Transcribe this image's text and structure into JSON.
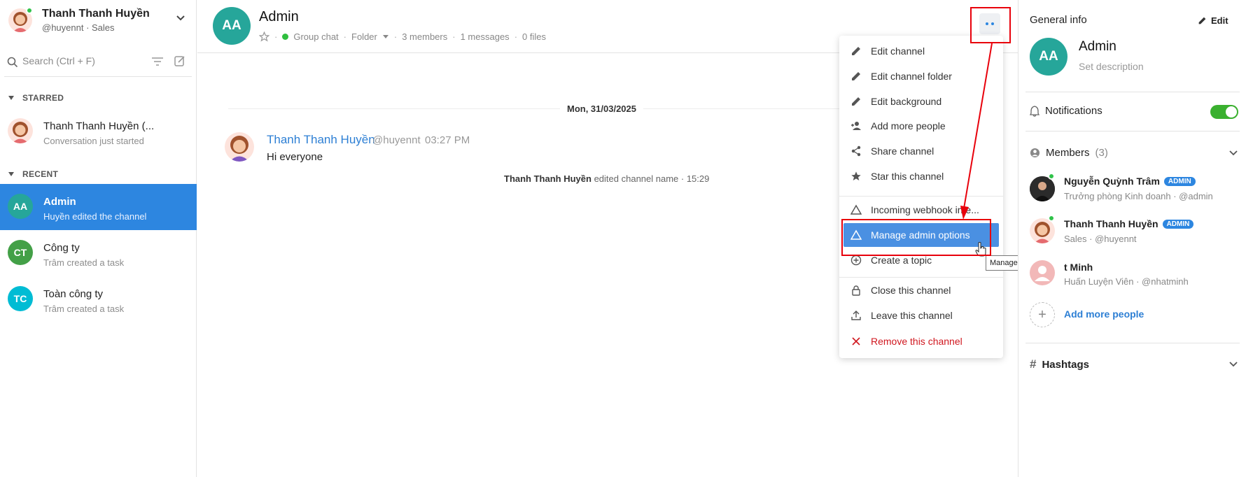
{
  "colors": {
    "accent": "#2d86e0",
    "online": "#30c24a",
    "danger": "#d0171f",
    "annotation": "#e8000b",
    "highlight": "#4a90e2"
  },
  "sidebar": {
    "user": {
      "name": "Thanh Thanh Huyền",
      "subtitle": "@huyennt · Sales"
    },
    "search": {
      "placeholder": "Search (Ctrl + F)"
    },
    "starred_label": "STARRED",
    "recent_label": "RECENT",
    "starred": [
      {
        "title": "Thanh Thanh Huyền (...",
        "subtitle": "Conversation just started"
      }
    ],
    "recent": [
      {
        "initials": "AA",
        "title": "Admin",
        "subtitle": "Huyền edited the channel",
        "color": "#26a69a"
      },
      {
        "initials": "CT",
        "title": "Công ty",
        "subtitle": "Trâm created a task",
        "color": "#43a047"
      },
      {
        "initials": "TC",
        "title": "Toàn công ty",
        "subtitle": "Trâm created a task",
        "color": "#00bcd4"
      }
    ]
  },
  "channel": {
    "initials": "AA",
    "title": "Admin",
    "type": "Group chat",
    "folder": "Folder",
    "members": "3 members",
    "messages": "1 messages",
    "files": "0 files"
  },
  "chat": {
    "date": "Mon, 31/03/2025",
    "message": {
      "author": "Thanh Thanh Huyền",
      "handle": "@huyennt",
      "time": "03:27 PM",
      "text": "Hi everyone"
    },
    "system": {
      "actor": "Thanh Thanh Huyền",
      "action": "edited channel name · 15:29"
    }
  },
  "menu": {
    "items": [
      {
        "label": "Edit channel",
        "icon": "pencil-icon"
      },
      {
        "label": "Edit channel folder",
        "icon": "pencil-icon"
      },
      {
        "label": "Edit background",
        "icon": "pencil-icon"
      },
      {
        "label": "Add more people",
        "icon": "person-add-icon"
      },
      {
        "label": "Share channel",
        "icon": "share-icon"
      },
      {
        "label": "Star this channel",
        "icon": "star-icon"
      },
      {
        "label": "Incoming webhook inte...",
        "icon": "triangle-icon"
      },
      {
        "label": "Manage admin options",
        "icon": "triangle-icon"
      },
      {
        "label": "Create a topic",
        "icon": "plus-circle-icon"
      },
      {
        "label": "Close this channel",
        "icon": "lock-icon"
      },
      {
        "label": "Leave this channel",
        "icon": "upload-icon"
      },
      {
        "label": "Remove this channel",
        "icon": "close-icon"
      }
    ],
    "tooltip": "Manage admin options"
  },
  "info": {
    "title": "General info",
    "edit_label": "Edit",
    "channel_initials": "AA",
    "channel_name": "Admin",
    "description_placeholder": "Set description",
    "notifications_label": "Notifications",
    "notifications_on": true,
    "members_label": "Members",
    "members_count": "3",
    "members": [
      {
        "name": "Nguyễn Quỳnh Trâm",
        "badge": "ADMIN",
        "subtitle": "Trưởng phòng Kinh doanh · @admin"
      },
      {
        "name": "Thanh Thanh Huyền",
        "badge": "ADMIN",
        "subtitle": "Sales · @huyennt"
      },
      {
        "name": "t Minh",
        "badge": "",
        "subtitle": "Huấn Luyện Viên · @nhatminh"
      }
    ],
    "add_people_label": "Add more people",
    "hashtags_label": "Hashtags"
  }
}
